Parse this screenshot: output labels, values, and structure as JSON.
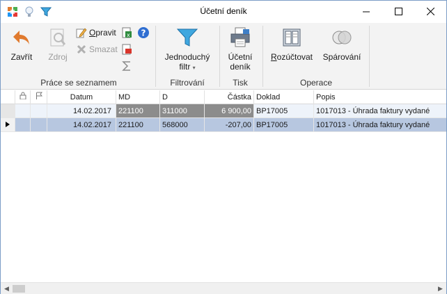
{
  "window": {
    "title": "Účetní deník"
  },
  "quick_access": [
    "app-icon",
    "lightbulb-icon",
    "filter-icon"
  ],
  "ribbon": {
    "groups": [
      {
        "label": "Práce se seznamem"
      },
      {
        "label": "Filtrování"
      },
      {
        "label": "Tisk"
      },
      {
        "label": "Operace"
      }
    ],
    "buttons": {
      "zavrit": "Zavřít",
      "zdroj": "Zdroj",
      "opravit": "Opravit",
      "smazat": "Smazat",
      "filtr_line1": "Jednoduchý",
      "filtr_line2": "filtr",
      "tisk_line1": "Účetní",
      "tisk_line2": "deník",
      "rozuctovat": "Rozúčtovat",
      "sparovani": "Spárování"
    }
  },
  "grid": {
    "columns": {
      "datum": "Datum",
      "md": "MD",
      "d": "D",
      "castka": "Částka",
      "doklad": "Doklad",
      "popis": "Popis"
    },
    "rows": [
      {
        "datum": "14.02.2017",
        "md": "221100",
        "d": "311000",
        "castka": "6 900,00",
        "doklad": "BP17005",
        "popis": "1017013 - Úhrada faktury vydané"
      },
      {
        "datum": "14.02.2017",
        "md": "221100",
        "d": "568000",
        "castka": "-207,00",
        "doklad": "BP17005",
        "popis": "1017013 - Úhrada faktury vydané"
      }
    ]
  },
  "colors": {
    "accent_orange": "#e07a2e",
    "selected_row": "#b7c7e0",
    "dark_cell": "#8c8c8c",
    "row_first": "#eef3fa"
  }
}
